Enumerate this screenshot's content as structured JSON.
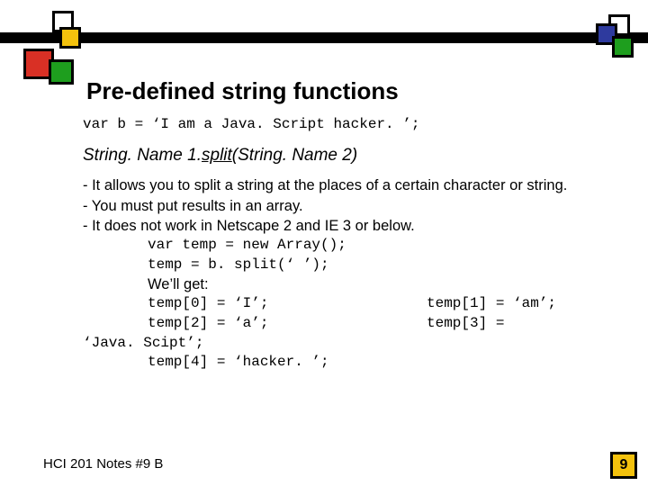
{
  "title": "Pre-defined string functions",
  "decl": "var b = ‘I am a Java. Script hacker. ’;",
  "fn": {
    "recv": "String. Name 1.",
    "name": "split",
    "arg": "(String. Name 2)"
  },
  "bullets": {
    "b1": "- It allows you to split a string at the places of a certain character or string.",
    "b2": "- You must put results in an array.",
    "b3": "- It does not work in Netscape 2 and IE 3 or below."
  },
  "ex": {
    "l1": "var temp = new Array();",
    "l2": "temp = b. split(‘ ’);",
    "l3": "We’ll get:",
    "r0a": "temp[0] = ‘I’;",
    "r0b": "temp[1] = ‘am’;",
    "r1a": "temp[2] = ‘a’;",
    "r1b": "temp[3] =",
    "r2": "‘Java. Scipt’;",
    "r3": "temp[4] = ‘hacker. ’;"
  },
  "footer": "HCI 201 Notes #9 B",
  "page": "9"
}
